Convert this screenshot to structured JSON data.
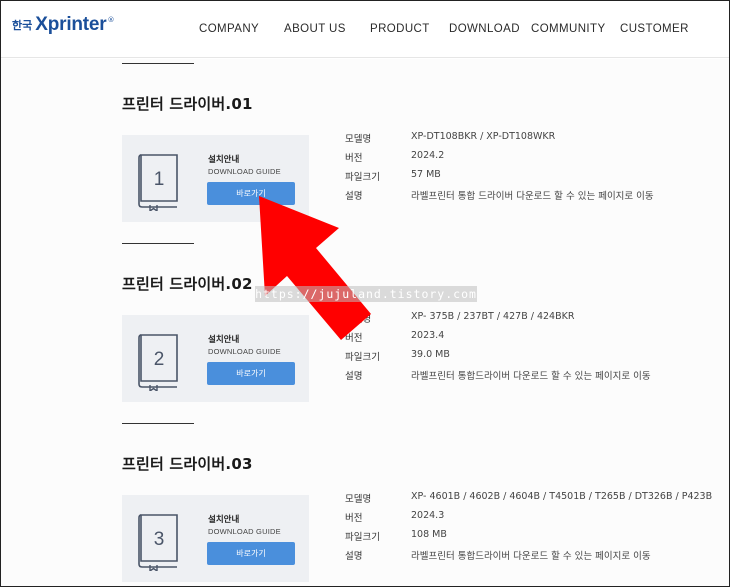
{
  "logo": {
    "korean": "한국",
    "brand": "Xprinter",
    "reg": "®"
  },
  "nav": [
    {
      "label": "COMPANY"
    },
    {
      "label": "ABOUT US"
    },
    {
      "label": "PRODUCT"
    },
    {
      "label": "DOWNLOAD"
    },
    {
      "label": "COMMUNITY"
    },
    {
      "label": "CUSTOMER"
    }
  ],
  "sections": [
    {
      "title": "프린터 드라이버.01",
      "card": {
        "number": "1",
        "title": "설치안내",
        "subtitle": "DOWNLOAD GUIDE",
        "button": "바로가기"
      },
      "specs": [
        {
          "label": "모델명",
          "value": "XP-DT108BKR / XP-DT108WKR"
        },
        {
          "label": "버전",
          "value": "2024.2"
        },
        {
          "label": "파일크기",
          "value": "57 MB"
        },
        {
          "label": "설명",
          "value": "라벨프린터 통합 드라이버 다운로드 할 수 있는 페이지로 이동"
        }
      ]
    },
    {
      "title": "프린터 드라이버.02",
      "card": {
        "number": "2",
        "title": "설치안내",
        "subtitle": "DOWNLOAD GUIDE",
        "button": "바로가기"
      },
      "specs": [
        {
          "label": "모델명",
          "value": "XP- 375B / 237BT / 427B / 424BKR"
        },
        {
          "label": "버전",
          "value": "2023.4"
        },
        {
          "label": "파일크기",
          "value": "39.0 MB"
        },
        {
          "label": "설명",
          "value": "라벨프린터 통합드라이버 다운로드 할 수 있는 페이지로 이동"
        }
      ]
    },
    {
      "title": "프린터 드라이버.03",
      "card": {
        "number": "3",
        "title": "설치안내",
        "subtitle": "DOWNLOAD GUIDE",
        "button": "바로가기"
      },
      "specs": [
        {
          "label": "모델명",
          "value": "XP- 4601B / 4602B / 4604B / T4501B / T265B / DT326B / P423B"
        },
        {
          "label": "버전",
          "value": "2024.3"
        },
        {
          "label": "파일크기",
          "value": "108 MB"
        },
        {
          "label": "설명",
          "value": "라벨프린터 통합드라이버 다운로드 할 수 있는 페이지로 이동"
        }
      ]
    }
  ],
  "watermark": "https://jujuland.tistory.com",
  "colors": {
    "brand": "#1b4f9a",
    "button": "#4a8fdc",
    "card_bg": "#eef0f3",
    "arrow": "#ff0000"
  }
}
